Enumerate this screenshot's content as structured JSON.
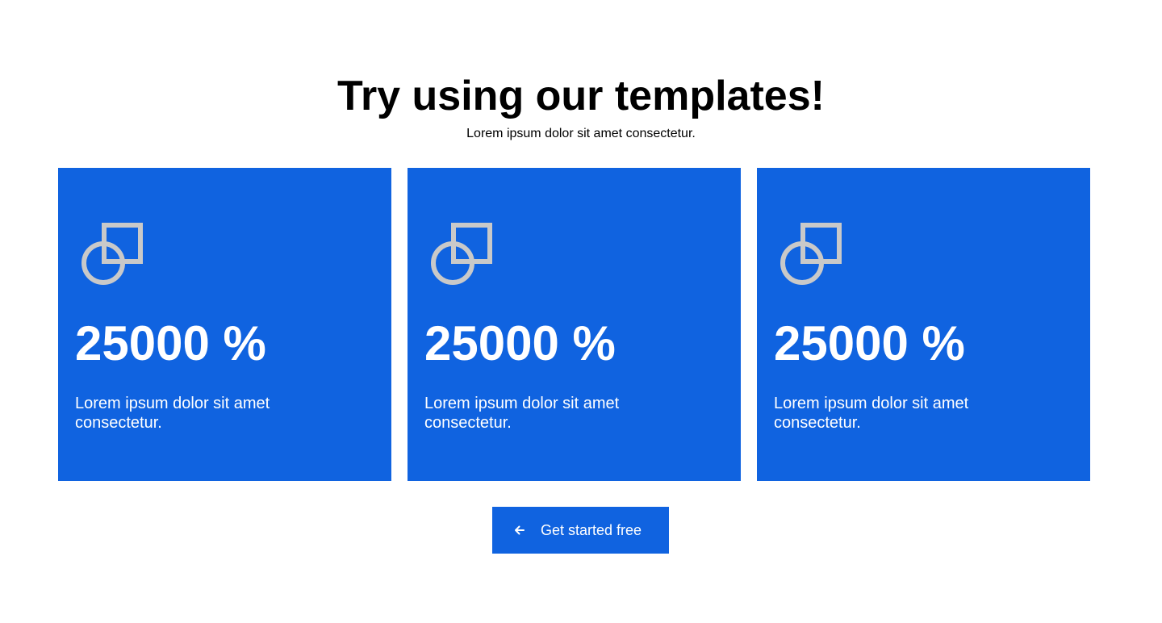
{
  "colors": {
    "accent": "#1063e0",
    "icon_stroke": "#c9c9c9",
    "text_dark": "#000000",
    "text_light": "#ffffff"
  },
  "header": {
    "title": "Try using our templates!",
    "subtitle": "Lorem ipsum dolor sit amet consectetur."
  },
  "cards": [
    {
      "icon": "shapes-icon",
      "value": "25000 %",
      "description": "Lorem ipsum dolor sit amet consectetur."
    },
    {
      "icon": "shapes-icon",
      "value": "25000 %",
      "description": "Lorem ipsum dolor sit amet consectetur."
    },
    {
      "icon": "shapes-icon",
      "value": "25000 %",
      "description": "Lorem ipsum dolor sit amet consectetur."
    }
  ],
  "cta": {
    "label": "Get started free",
    "icon": "arrow-left-icon"
  }
}
